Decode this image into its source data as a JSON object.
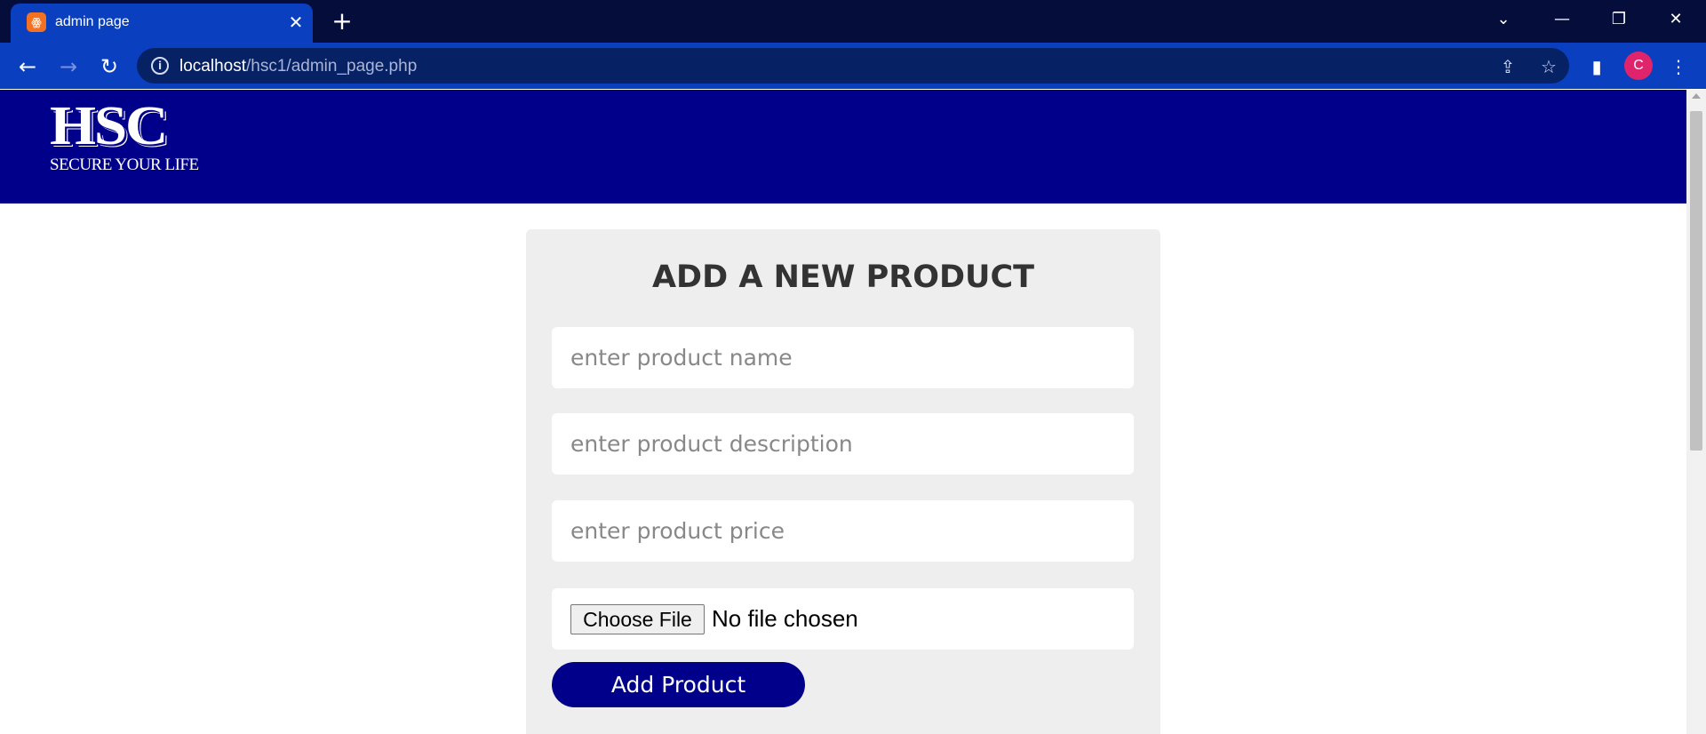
{
  "browser": {
    "tab": {
      "title": "admin page",
      "favicon_icon": "xampp-icon",
      "close_glyph": "✕"
    },
    "new_tab_glyph": "+",
    "window_controls": {
      "tab_search": "⌄",
      "minimize": "—",
      "restore": "❐",
      "close": "✕"
    },
    "nav": {
      "back": "←",
      "forward": "→",
      "reload": "↻"
    },
    "address": {
      "host": "localhost",
      "path": "/hsc1/admin_page.php"
    },
    "omnibox_icons": {
      "share": "⇪",
      "bookmark": "☆"
    },
    "toolbar_icons": {
      "side_panel": "▮",
      "menu": "⋮"
    },
    "profile_initial": "C"
  },
  "header": {
    "logo_text": "HSC",
    "logo_tagline": "SECURE YOUR LIFE",
    "background": "#00008b"
  },
  "form": {
    "title": "ADD A NEW PRODUCT",
    "name_placeholder": "enter product name",
    "description_placeholder": "enter product description",
    "price_placeholder": "enter product price",
    "file_button": "Choose File",
    "file_status": "No file chosen",
    "submit_label": "Add Product"
  },
  "colors": {
    "accent": "#00008b",
    "card": "#eeeeee",
    "chrome_tab": "#0a3fc0",
    "chrome_frame": "#050e3a",
    "avatar": "#e0246b"
  }
}
